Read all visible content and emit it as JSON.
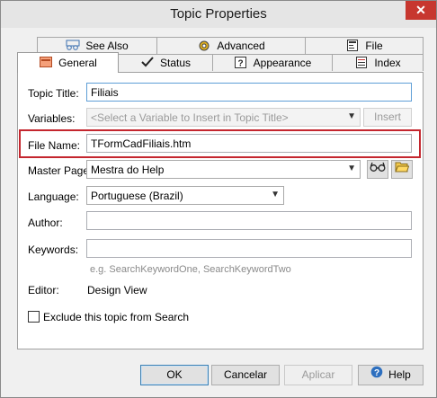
{
  "window": {
    "title": "Topic Properties",
    "close_symbol": "✕"
  },
  "tabs_back": [
    {
      "label": "See Also",
      "icon": "see-also-icon"
    },
    {
      "label": "Advanced",
      "icon": "gear-icon"
    },
    {
      "label": "File",
      "icon": "file-icon"
    }
  ],
  "tabs_front": [
    {
      "label": "General",
      "icon": "general-icon"
    },
    {
      "label": "Status",
      "icon": "checkmark-icon"
    },
    {
      "label": "Appearance",
      "icon": "help-icon"
    },
    {
      "label": "Index",
      "icon": "index-icon"
    }
  ],
  "form": {
    "topic_title_label": "Topic Title:",
    "topic_title_value": "Filiais",
    "variables_label": "Variables:",
    "variables_placeholder": "<Select a Variable to Insert in Topic Title>",
    "insert_label": "Insert",
    "file_name_label": "File Name:",
    "file_name_value": "TFormCadFiliais.htm",
    "master_page_label": "Master Page:",
    "master_page_value": "Mestra do Help",
    "language_label": "Language:",
    "language_value": "Portuguese (Brazil)",
    "author_label": "Author:",
    "author_value": "",
    "keywords_label": "Keywords:",
    "keywords_value": "",
    "keywords_hint": "e.g. SearchKeywordOne, SearchKeywordTwo",
    "editor_label": "Editor:",
    "editor_value": "Design View",
    "exclude_label": "Exclude this topic from Search",
    "exclude_checked": false
  },
  "buttons": {
    "ok": "OK",
    "cancel": "Cancelar",
    "apply": "Aplicar",
    "help": "Help"
  },
  "colors": {
    "highlight": "#c4262e",
    "accent": "#3c7fb1"
  }
}
